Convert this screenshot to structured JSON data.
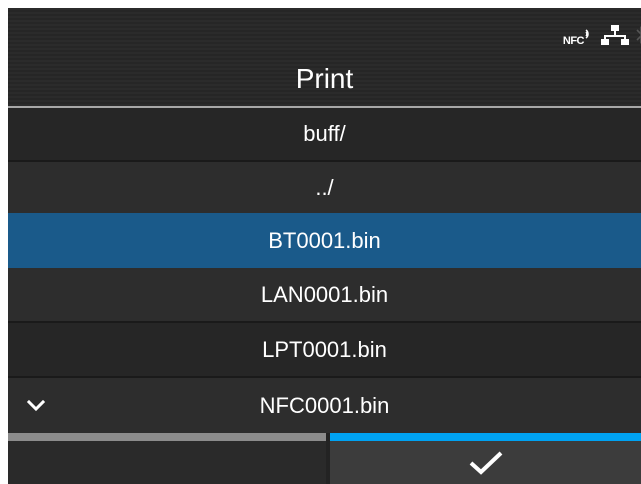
{
  "header": {
    "title": "Print"
  },
  "status_icons": [
    "nfc-icon",
    "lan-network-icon",
    "bluetooth-icon"
  ],
  "status": {
    "nfc_label": "NFC"
  },
  "file_list": {
    "path": "buff/",
    "items": [
      {
        "label": "../"
      },
      {
        "label": "BT0001.bin",
        "selected": true
      },
      {
        "label": "LAN0001.bin"
      },
      {
        "label": "LPT0001.bin"
      },
      {
        "label": "NFC0001.bin"
      }
    ]
  },
  "footer": {
    "confirm_icon": "checkmark-icon"
  },
  "colors": {
    "selected_row": "#1a5a8a",
    "accent_bar": "#00a2f2",
    "inactive_bar": "#8c8c8c"
  }
}
